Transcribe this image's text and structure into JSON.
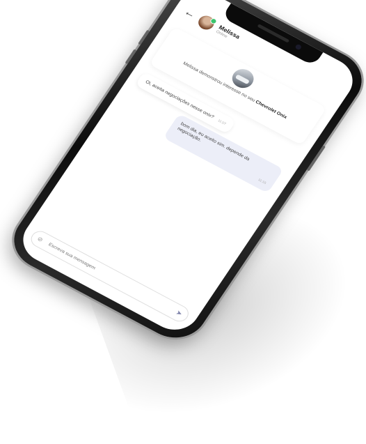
{
  "contact": {
    "name": "Melissa",
    "status": "Online"
  },
  "offer": {
    "text_prefix": "Melissa demonstrou interesse no seu",
    "car_name": "Chevrolet Onix"
  },
  "messages": [
    {
      "text": "Oi, aceita negociações nesse onix?",
      "time": "11:07"
    },
    {
      "text": "bom dia, eu aceito sim. depende da negociação.",
      "time": "11:15"
    }
  ],
  "composer": {
    "placeholder": "Escreva sua mensagem"
  },
  "icons": {
    "back": "arrow-left-icon",
    "attach": "attachment-icon",
    "send": "send-icon"
  }
}
